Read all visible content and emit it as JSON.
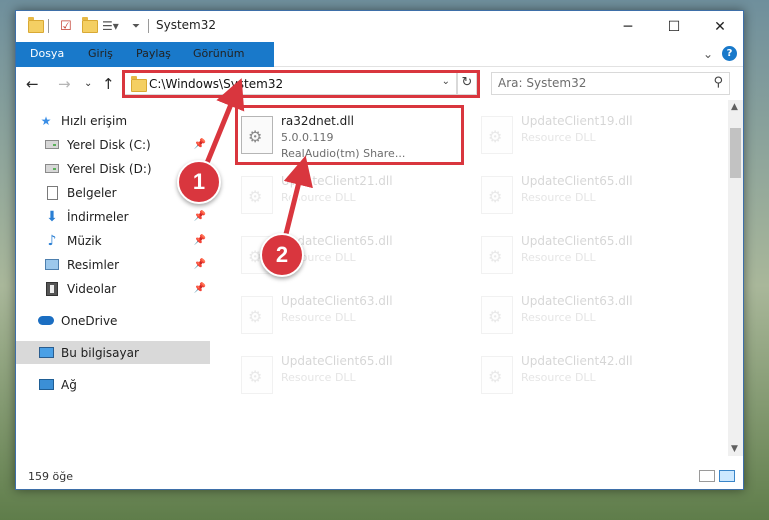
{
  "window": {
    "title": "System32",
    "controls": {
      "minimize": "─",
      "maximize": "☐",
      "close": "✕"
    }
  },
  "ribbon": {
    "tabs": [
      "Dosya",
      "Giriş",
      "Paylaş",
      "Görünüm"
    ]
  },
  "nav": {
    "address_path": "C:\\Windows\\System32",
    "search_placeholder": "Ara: System32"
  },
  "sidebar": {
    "items": [
      {
        "label": "Hızlı erişim",
        "icon": "star-icon"
      },
      {
        "label": "Yerel Disk (C:)",
        "icon": "drive-icon",
        "pinned": true
      },
      {
        "label": "Yerel Disk (D:)",
        "icon": "drive-icon"
      },
      {
        "label": "Belgeler",
        "icon": "documents-icon"
      },
      {
        "label": "İndirmeler",
        "icon": "download-icon",
        "pinned": true
      },
      {
        "label": "Müzik",
        "icon": "music-icon",
        "pinned": true
      },
      {
        "label": "Resimler",
        "icon": "pictures-icon",
        "pinned": true
      },
      {
        "label": "Videolar",
        "icon": "videos-icon",
        "pinned": true
      },
      {
        "label": "OneDrive",
        "icon": "cloud-icon"
      },
      {
        "label": "Bu bilgisayar",
        "icon": "computer-icon",
        "selected": true
      },
      {
        "label": "Ağ",
        "icon": "network-icon"
      }
    ]
  },
  "files": [
    {
      "name": "ra32dnet.dll",
      "line2": "5.0.0.119",
      "line3": "RealAudio(tm) Share...",
      "highlighted": true
    },
    {
      "name": "UpdateClient19.dll",
      "line2": "Resource DLL"
    },
    {
      "name": "UpdateClient21.dll",
      "line2": "Resource DLL"
    },
    {
      "name": "UpdateClient65.dll",
      "line2": "Resource DLL"
    },
    {
      "name": "UpdateClient65.dll",
      "line2": "Resource DLL"
    },
    {
      "name": "UpdateClient65.dll",
      "line2": "Resource DLL"
    },
    {
      "name": "UpdateClient63.dll",
      "line2": "Resource DLL"
    },
    {
      "name": "UpdateClient63.dll",
      "line2": "Resource DLL"
    },
    {
      "name": "UpdateClient65.dll",
      "line2": "Resource DLL"
    },
    {
      "name": "UpdateClient42.dll",
      "line2": "Resource DLL"
    }
  ],
  "status": {
    "item_count": "159 öğe"
  },
  "annotations": {
    "step1": "1",
    "step2": "2",
    "highlight_color": "#d9363e"
  }
}
